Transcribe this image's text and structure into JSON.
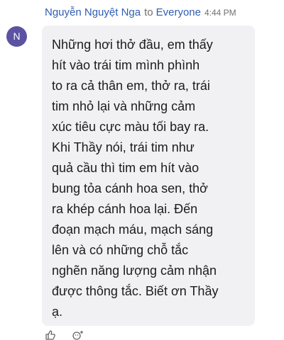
{
  "message": {
    "avatar_initial": "N",
    "sender_name": "Nguyễn Nguyệt Nga",
    "to_label": "to",
    "audience": "Everyone",
    "time": "4:44 PM",
    "text": "Những hơi thở đầu, em thấy\nhít vào trái tim mình phình\nto ra cả thân em, thở ra, trái\ntim nhỏ lại và những cảm\nxúc tiêu cực màu tối bay ra.\nKhi Thầy nói, trái tim như\nquả cầu thì tim em hít vào\nbung tỏa cánh hoa sen, thở\nra khép cánh hoa lại. Đến\nđoạn mạch máu, mạch sáng\nlên và có những chỗ tắc\nnghẽn năng lượng cảm nhận\nđược thông tắc. Biết ơn Thầy\nạ."
  },
  "colors": {
    "avatar": "#5c52a3",
    "name": "#2f5eb1",
    "bubble": "#f1f1f3"
  },
  "icons": [
    "thumbs-up-icon",
    "add-reaction-icon"
  ]
}
